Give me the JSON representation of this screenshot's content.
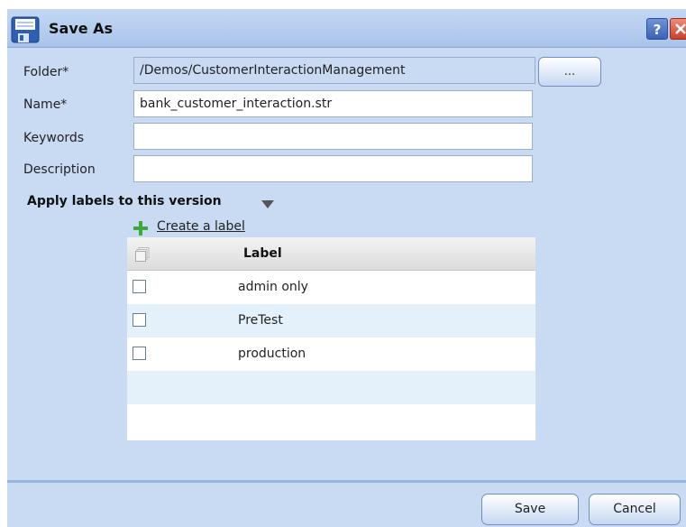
{
  "window": {
    "title": "Save As",
    "help_label": "?"
  },
  "form": {
    "folder_label": "Folder*",
    "folder_value": "/Demos/CustomerInteractionManagement",
    "browse_label": "...",
    "name_label": "Name*",
    "name_value": "bank_customer_interaction.str",
    "keywords_label": "Keywords",
    "keywords_value": "",
    "description_label": "Description",
    "description_value": ""
  },
  "labels_section": {
    "title": "Apply labels to this version",
    "create_link": "Create a label",
    "column_header": "Label",
    "rows": [
      {
        "label": "admin only",
        "checked": false
      },
      {
        "label": "PreTest",
        "checked": false
      },
      {
        "label": "production",
        "checked": false
      }
    ]
  },
  "buttons": {
    "save": "Save",
    "cancel": "Cancel"
  },
  "colors": {
    "dialog_bg": "#c9dbf3",
    "row_alt": "#e4f1fb"
  }
}
